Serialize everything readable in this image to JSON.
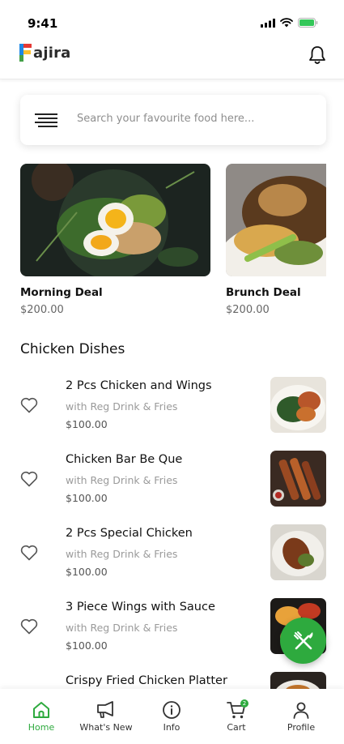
{
  "status_bar": {
    "time": "9:41"
  },
  "header": {
    "app_name": "ajira",
    "logo_letter": "F"
  },
  "search": {
    "placeholder": "Search your favourite food here..."
  },
  "deals": [
    {
      "name": "Morning Deal",
      "price": "$200.00"
    },
    {
      "name": "Brunch Deal",
      "price": "$200.00"
    }
  ],
  "section": {
    "title": "Chicken Dishes"
  },
  "dishes": [
    {
      "name": "2 Pcs Chicken and Wings",
      "sub": "with Reg Drink & Fries",
      "price": "$100.00"
    },
    {
      "name": "Chicken Bar Be Que",
      "sub": "with Reg Drink & Fries",
      "price": "$100.00"
    },
    {
      "name": "2 Pcs Special Chicken",
      "sub": "with Reg Drink & Fries",
      "price": "$100.00"
    },
    {
      "name": "3 Piece Wings  with Sauce",
      "sub": "with Reg Drink & Fries",
      "price": "$100.00"
    },
    {
      "name": "Crispy Fried Chicken Platter",
      "sub": "",
      "price": ""
    }
  ],
  "nav": {
    "home": "Home",
    "whats_new": "What's New",
    "info": "Info",
    "cart": "Cart",
    "cart_count": "2",
    "profile": "Profile"
  },
  "colors": {
    "accent": "#2eaa3e",
    "logo_red": "#e53935",
    "logo_yellow": "#fbc02d",
    "logo_blue": "#1e88e5",
    "logo_green": "#43a047"
  }
}
